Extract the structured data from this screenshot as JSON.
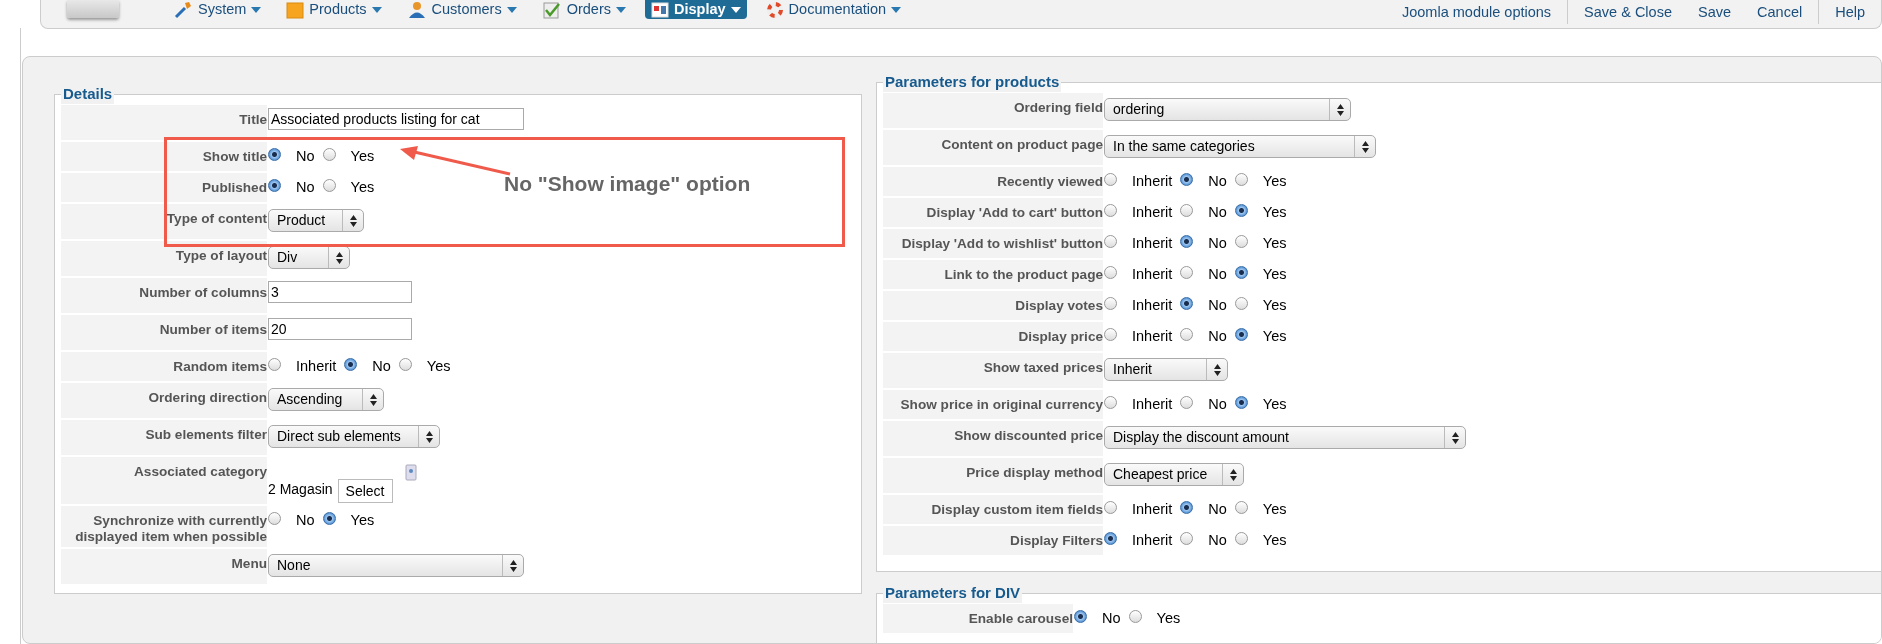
{
  "toolbar": {
    "menus": [
      {
        "label": "System",
        "selected": false
      },
      {
        "label": "Products",
        "selected": false
      },
      {
        "label": "Customers",
        "selected": false
      },
      {
        "label": "Orders",
        "selected": false
      },
      {
        "label": "Display",
        "selected": true
      },
      {
        "label": "Documentation",
        "selected": false
      }
    ],
    "action_groups": [
      [
        "Joomla module options"
      ],
      [
        "Save & Close",
        "Save",
        "Cancel"
      ],
      [
        "Help"
      ]
    ]
  },
  "details": {
    "legend": "Details",
    "fields": [
      {
        "label": "Title",
        "kind": "text",
        "value": "Associated products listing for cat"
      },
      {
        "label": "Show title",
        "kind": "radio",
        "options": [
          {
            "label": "No",
            "selected": true
          },
          {
            "label": "Yes",
            "selected": false
          }
        ]
      },
      {
        "label": "Published",
        "kind": "radio",
        "options": [
          {
            "label": "No",
            "selected": true
          },
          {
            "label": "Yes",
            "selected": false
          }
        ]
      },
      {
        "label": "Type of content",
        "kind": "select",
        "value": "Product"
      },
      {
        "label": "Type of layout",
        "kind": "select",
        "value": "Div"
      },
      {
        "label": "Number of columns",
        "kind": "text",
        "value": "3"
      },
      {
        "label": "Number of items",
        "kind": "text",
        "value": "20"
      },
      {
        "label": "Random items",
        "kind": "radio",
        "options": [
          {
            "label": "Inherit",
            "selected": false
          },
          {
            "label": "No",
            "selected": true
          },
          {
            "label": "Yes",
            "selected": false
          }
        ]
      },
      {
        "label": "Ordering direction",
        "kind": "select",
        "value": "Ascending"
      },
      {
        "label": "Sub elements filter",
        "kind": "select",
        "value": "Direct sub elements"
      },
      {
        "label": "Associated category",
        "kind": "category",
        "value": "2 Magasin",
        "button": "Select"
      },
      {
        "label": "Synchronize with currently displayed item when possible",
        "kind": "radio",
        "options": [
          {
            "label": "No",
            "selected": false
          },
          {
            "label": "Yes",
            "selected": true
          }
        ]
      },
      {
        "label": "Menu",
        "kind": "select",
        "value": "None"
      }
    ]
  },
  "products": {
    "legend": "Parameters for products",
    "fields": [
      {
        "label": "Ordering field",
        "kind": "select",
        "value": "ordering"
      },
      {
        "label": "Content on product page",
        "kind": "select",
        "value": "In the same categories"
      },
      {
        "label": "Recently viewed",
        "kind": "radio",
        "options": [
          {
            "label": "Inherit",
            "selected": false
          },
          {
            "label": "No",
            "selected": true
          },
          {
            "label": "Yes",
            "selected": false
          }
        ]
      },
      {
        "label": "Display 'Add to cart' button",
        "kind": "radio",
        "options": [
          {
            "label": "Inherit",
            "selected": false
          },
          {
            "label": "No",
            "selected": false
          },
          {
            "label": "Yes",
            "selected": true
          }
        ]
      },
      {
        "label": "Display 'Add to wishlist' button",
        "kind": "radio",
        "options": [
          {
            "label": "Inherit",
            "selected": false
          },
          {
            "label": "No",
            "selected": true
          },
          {
            "label": "Yes",
            "selected": false
          }
        ]
      },
      {
        "label": "Link to the product page",
        "kind": "radio",
        "options": [
          {
            "label": "Inherit",
            "selected": false
          },
          {
            "label": "No",
            "selected": false
          },
          {
            "label": "Yes",
            "selected": true
          }
        ]
      },
      {
        "label": "Display votes",
        "kind": "radio",
        "options": [
          {
            "label": "Inherit",
            "selected": false
          },
          {
            "label": "No",
            "selected": true
          },
          {
            "label": "Yes",
            "selected": false
          }
        ]
      },
      {
        "label": "Display price",
        "kind": "radio",
        "options": [
          {
            "label": "Inherit",
            "selected": false
          },
          {
            "label": "No",
            "selected": false
          },
          {
            "label": "Yes",
            "selected": true
          }
        ]
      },
      {
        "label": "Show taxed prices",
        "kind": "select",
        "value": "Inherit"
      },
      {
        "label": "Show price in original currency",
        "kind": "radio",
        "options": [
          {
            "label": "Inherit",
            "selected": false
          },
          {
            "label": "No",
            "selected": false
          },
          {
            "label": "Yes",
            "selected": true
          }
        ]
      },
      {
        "label": "Show discounted price",
        "kind": "select",
        "value": "Display the discount amount"
      },
      {
        "label": "Price display method",
        "kind": "select",
        "value": "Cheapest price"
      },
      {
        "label": "Display custom item fields",
        "kind": "radio",
        "options": [
          {
            "label": "Inherit",
            "selected": false
          },
          {
            "label": "No",
            "selected": true
          },
          {
            "label": "Yes",
            "selected": false
          }
        ]
      },
      {
        "label": "Display Filters",
        "kind": "radio",
        "options": [
          {
            "label": "Inherit",
            "selected": true
          },
          {
            "label": "No",
            "selected": false
          },
          {
            "label": "Yes",
            "selected": false
          }
        ]
      }
    ]
  },
  "div_params": {
    "legend": "Parameters for DIV",
    "fields": [
      {
        "label": "Enable carousel",
        "kind": "radio",
        "options": [
          {
            "label": "No",
            "selected": true
          },
          {
            "label": "Yes",
            "selected": false
          }
        ]
      }
    ]
  },
  "annotation": {
    "text": "No \"Show image\" option"
  }
}
